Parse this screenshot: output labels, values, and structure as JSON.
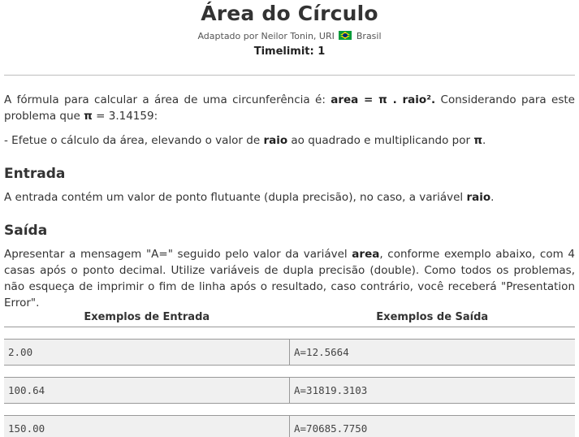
{
  "header": {
    "title": "Área do Círculo",
    "author_prefix": "Adaptado por Neilor Tonin, URI",
    "country": "Brasil",
    "timelimit": "Timelimit: 1"
  },
  "body": {
    "p1_a": "A fórmula para calcular a área de uma circunferência é: ",
    "p1_formula": "area = π . raio².",
    "p1_b": " Considerando para este problema que ",
    "p1_pi": "π",
    "p1_c": " = 3.14159:",
    "p2_a": "- Efetue o cálculo da área, elevando o valor de ",
    "p2_raio": "raio",
    "p2_b": " ao quadrado e multiplicando por ",
    "p2_pi": "π",
    "p2_c": ".",
    "entrada_heading": "Entrada",
    "entrada_a": "A entrada contém um valor de ponto flutuante (dupla precisão), no caso, a variável ",
    "entrada_raio": "raio",
    "entrada_b": ".",
    "saida_heading": "Saída",
    "saida_a": "Apresentar a mensagem \"A=\" seguido pelo valor da variável ",
    "saida_area": "area",
    "saida_b": ", conforme exemplo abaixo, com 4 casas após o ponto decimal. Utilize variáveis de dupla precisão (double). Como todos os problemas, não esqueça de imprimir o fim de linha após o resultado, caso contrário, você receberá \"Presentation Error\"."
  },
  "samples": {
    "input_header": "Exemplos de Entrada",
    "output_header": "Exemplos de Saída",
    "rows": [
      {
        "input": "2.00",
        "output": "A=12.5664"
      },
      {
        "input": "100.64",
        "output": "A=31819.3103"
      },
      {
        "input": "150.00",
        "output": "A=70685.7750"
      }
    ]
  },
  "colors": {
    "text": "#333333",
    "cell_bg": "#f0f0f0",
    "rule": "#bdbdbd"
  },
  "icons": {
    "flag": "brazil-flag-icon"
  }
}
